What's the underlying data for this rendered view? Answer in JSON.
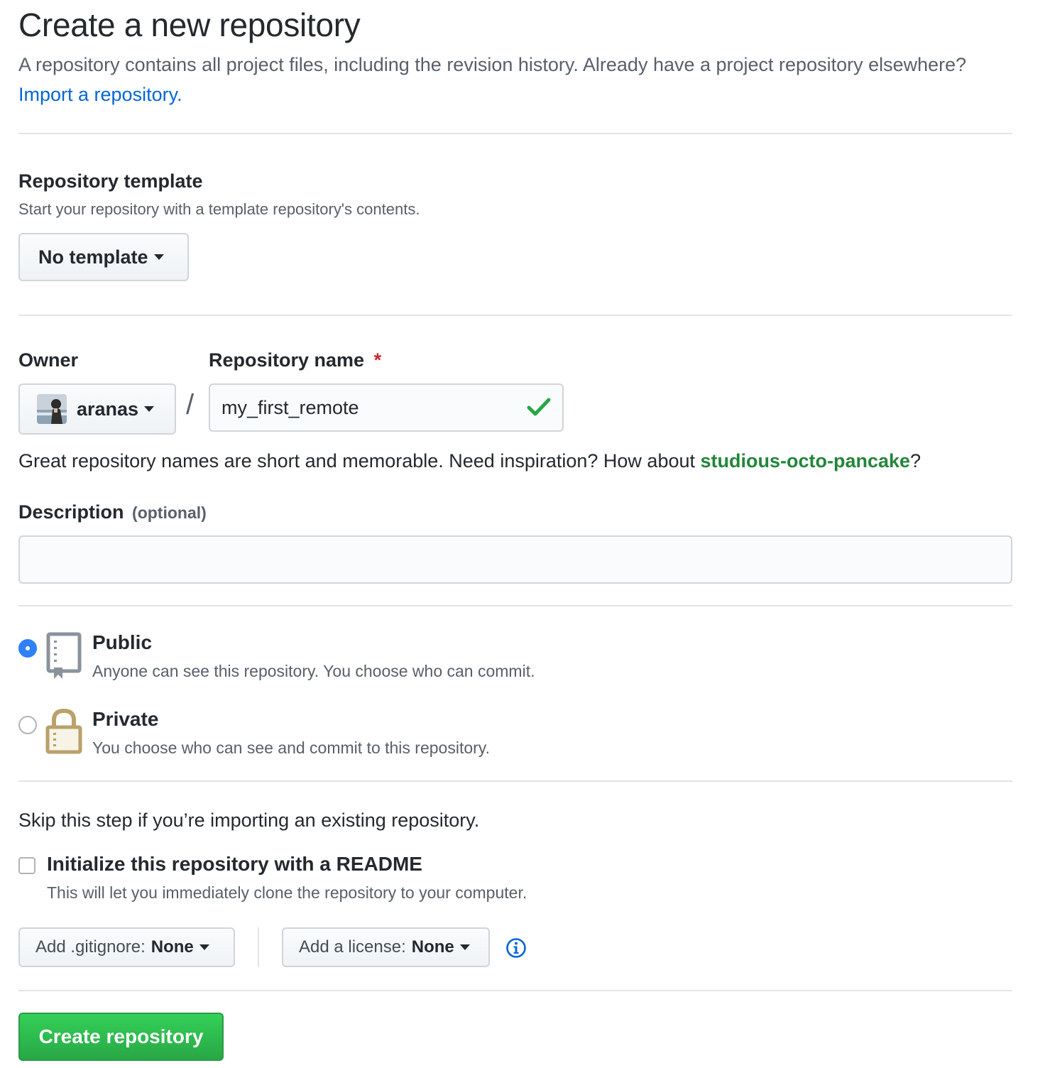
{
  "header": {
    "title": "Create a new repository",
    "intro_text": "A repository contains all project files, including the revision history. Already have a project repository elsewhere?",
    "import_link": "Import a repository."
  },
  "template": {
    "heading": "Repository template",
    "note": "Start your repository with a template repository's contents.",
    "button_label": "No template"
  },
  "owner": {
    "label": "Owner",
    "value": "aranas"
  },
  "separator": "/",
  "repo_name": {
    "label": "Repository name",
    "required_marker": "*",
    "value": "my_first_remote",
    "valid": true
  },
  "suggestion": {
    "text": "Great repository names are short and memorable. Need inspiration? How about",
    "name": "studious-octo-pancake",
    "suffix": "?"
  },
  "description": {
    "label": "Description",
    "optional": "(optional)",
    "value": ""
  },
  "visibility": {
    "selected": "public",
    "options": [
      {
        "id": "public",
        "title": "Public",
        "desc": "Anyone can see this repository. You choose who can commit.",
        "icon": "repo-book-icon"
      },
      {
        "id": "private",
        "title": "Private",
        "desc": "You choose who can see and commit to this repository.",
        "icon": "lock-icon"
      }
    ]
  },
  "init": {
    "skip_note": "Skip this step if you’re importing an existing repository.",
    "readme_label": "Initialize this repository with a README",
    "readme_desc": "This will let you immediately clone the repository to your computer.",
    "readme_checked": false
  },
  "gitignore": {
    "prefix": "Add .gitignore:",
    "value": "None"
  },
  "license": {
    "prefix": "Add a license:",
    "value": "None"
  },
  "info_icon": "info-icon",
  "submit": {
    "label": "Create repository"
  },
  "colors": {
    "link": "#0366d6",
    "suggestion": "#22863a",
    "required": "#cb2431",
    "check": "#28a745",
    "radio_checked": "#2f81f7",
    "create_btn": "#28a745",
    "lock": "#b9a16a"
  }
}
